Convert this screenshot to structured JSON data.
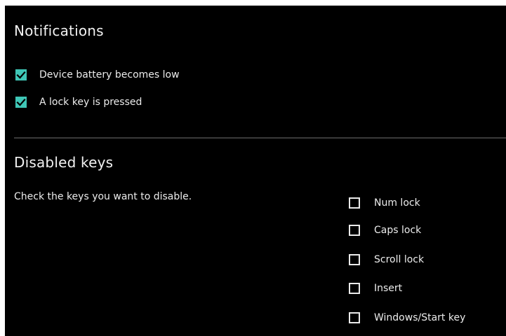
{
  "notifications": {
    "title": "Notifications",
    "items": [
      {
        "label": "Device battery becomes low",
        "checked": true
      },
      {
        "label": "A lock key is pressed",
        "checked": true
      }
    ]
  },
  "disabled_keys": {
    "title": "Disabled keys",
    "description": "Check the keys you want to disable.",
    "items": [
      {
        "label": "Num lock",
        "checked": false
      },
      {
        "label": "Caps lock",
        "checked": false
      },
      {
        "label": "Scroll lock",
        "checked": false
      },
      {
        "label": "Insert",
        "checked": false
      },
      {
        "label": "Windows/Start key",
        "checked": false
      }
    ]
  },
  "colors": {
    "background": "#000000",
    "accent": "#3fc6b6",
    "text": "#ececec",
    "divider": "#3a3a3a"
  },
  "icons": {
    "checked": "checkmark-icon"
  }
}
